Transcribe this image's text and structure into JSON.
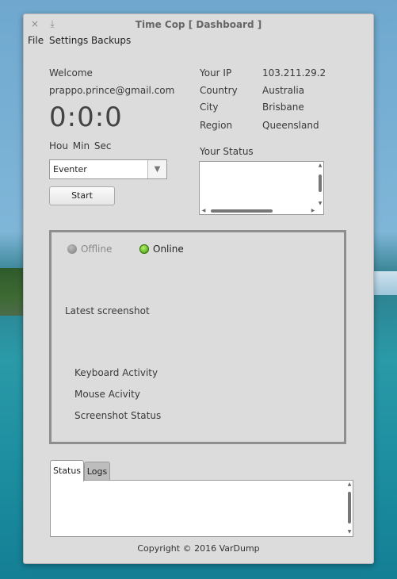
{
  "window": {
    "title": "Time Cop [ Dashboard ]",
    "close_glyph": "×",
    "minimize_glyph": "⤓"
  },
  "menu": [
    "File",
    "Settings",
    "Backups"
  ],
  "left": {
    "welcome": "Welcome",
    "email": "prappo.prince@gmail.com",
    "clock": "0:0:0",
    "clock_units": "Hou  Min  Sec",
    "project_select": "Eventer",
    "start_label": "Start"
  },
  "info": {
    "ip_label": "Your IP",
    "ip_value": "103.211.29.2",
    "country_label": "Country",
    "country_value": "Australia",
    "city_label": "City",
    "city_value": "Brisbane",
    "region_label": "Region",
    "region_value": "Queensland",
    "status_label": "Your Status"
  },
  "panel": {
    "offline": "Offline",
    "online": "Online",
    "latest_screenshot": "Latest screenshot",
    "keyboard": "Keyboard Activity",
    "mouse": "Mouse Acivity",
    "screenshot_status": "Screenshot Status"
  },
  "tabs": [
    "Status",
    "Logs"
  ],
  "footer": "Copyright © 2016 VarDump",
  "colors": {
    "online": "#5cc11a",
    "offline": "#8a8a8a",
    "window_bg": "#dcdcdc"
  }
}
